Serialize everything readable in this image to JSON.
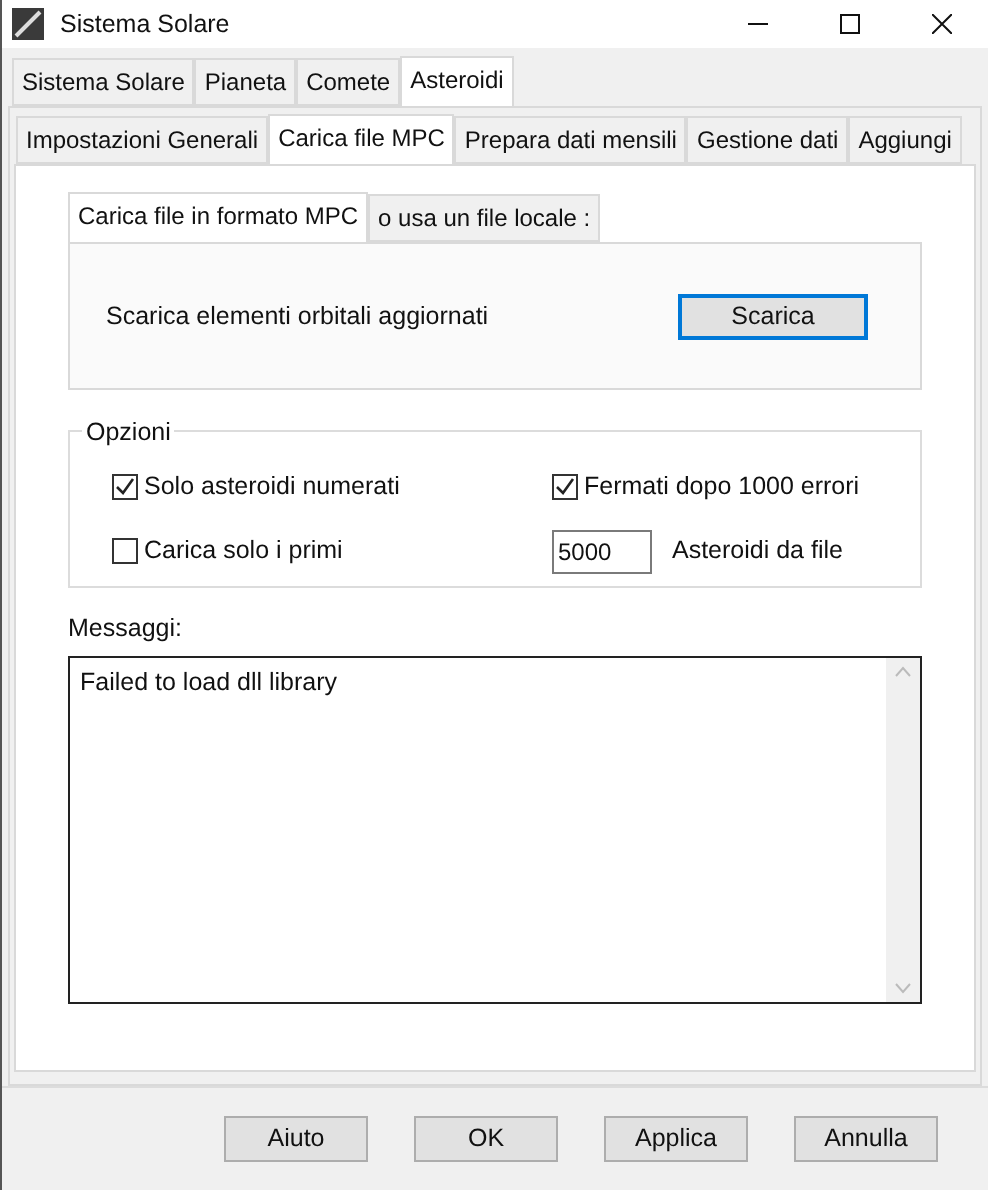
{
  "window": {
    "title": "Sistema Solare"
  },
  "tabs": [
    {
      "label": "Sistema Solare",
      "selected": false
    },
    {
      "label": "Pianeta",
      "selected": false
    },
    {
      "label": "Comete",
      "selected": false
    },
    {
      "label": "Asteroidi",
      "selected": true
    }
  ],
  "subtabs": [
    {
      "label": "Impostazioni Generali",
      "selected": false
    },
    {
      "label": "Carica file MPC",
      "selected": true
    },
    {
      "label": "Prepara dati mensili",
      "selected": false
    },
    {
      "label": "Gestione dati",
      "selected": false
    },
    {
      "label": "Aggiungi",
      "selected": false
    }
  ],
  "source_tabs": [
    {
      "label": "Carica file in formato MPC",
      "selected": true
    },
    {
      "label": "o usa un file locale :",
      "selected": false
    }
  ],
  "download": {
    "label": "Scarica elementi orbitali aggiornati",
    "button": "Scarica"
  },
  "options": {
    "title": "Opzioni",
    "items": [
      {
        "kind": "checkbox",
        "label": "Solo asteroidi numerati",
        "checked": true
      },
      {
        "kind": "checkbox",
        "label": "Fermati dopo 1000 errori",
        "checked": true
      },
      {
        "kind": "checkbox",
        "label": "Carica solo i primi",
        "checked": false
      },
      {
        "kind": "number",
        "value": "5000",
        "label": "Asteroidi da file"
      }
    ]
  },
  "messages": {
    "label": "Messaggi:",
    "text": "Failed to load dll library"
  },
  "buttons": [
    "Aiuto",
    "OK",
    "Applica",
    "Annulla"
  ]
}
